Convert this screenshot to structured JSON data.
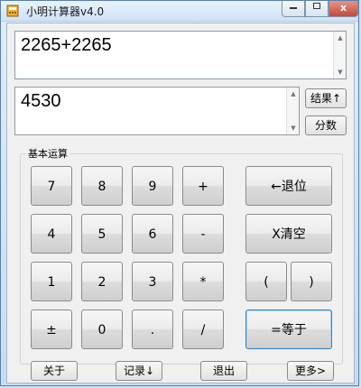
{
  "window": {
    "title": "小明计算器v4.0",
    "minimize_icon": "minimize-icon",
    "maximize_icon": "maximize-icon",
    "close_icon": "close-icon",
    "close_label": "x"
  },
  "expression": {
    "value": "2265+2265"
  },
  "result": {
    "value": "4530"
  },
  "side_buttons": {
    "result_label": "结果↑",
    "fraction_label": "分数"
  },
  "group": {
    "title": "基本运算"
  },
  "keys": {
    "k7": "7",
    "k8": "8",
    "k9": "9",
    "plus": "+",
    "k4": "4",
    "k5": "5",
    "k6": "6",
    "minus": "-",
    "k1": "1",
    "k2": "2",
    "k3": "3",
    "mul": "*",
    "sign": "±",
    "k0": "0",
    "dot": ".",
    "div": "/",
    "backspace": "←退位",
    "clear": "X清空",
    "lparen": "(",
    "rparen": ")",
    "equals": "=等于"
  },
  "footer": {
    "about": "关于",
    "history": "记录↓",
    "exit": "退出",
    "more": "更多>"
  }
}
